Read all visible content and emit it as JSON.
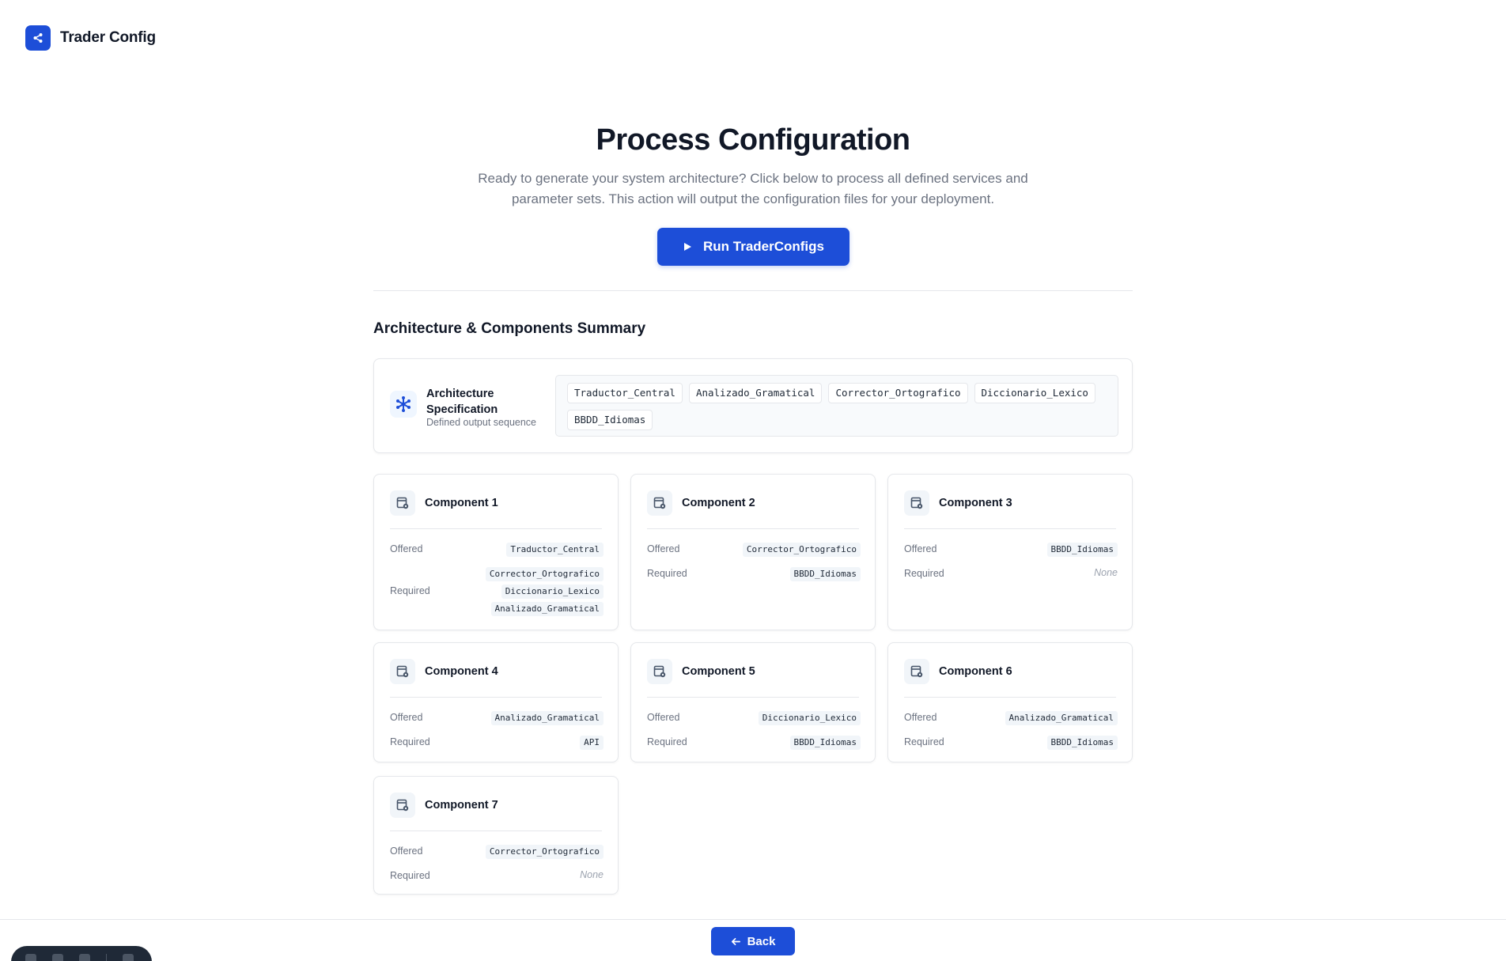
{
  "app": {
    "name": "Trader Config",
    "logo_icon": "share-nodes-icon"
  },
  "hero": {
    "title": "Process Configuration",
    "subtitle": "Ready to generate your system architecture? Click below to process all defined services and parameter sets. This action will output the configuration files for your deployment.",
    "run_label": "Run TraderConfigs"
  },
  "summary": {
    "title": "Architecture & Components Summary",
    "architecture": {
      "title": "Architecture Specification",
      "subtitle": "Defined output sequence",
      "sequence": [
        "Traductor_Central",
        "Analizado_Gramatical",
        "Corrector_Ortografico",
        "Diccionario_Lexico",
        "BBDD_Idiomas"
      ]
    },
    "offered_label": "Offered",
    "required_label": "Required",
    "none_label": "None",
    "components": [
      {
        "name": "Component 1",
        "offered": [
          "Traductor_Central"
        ],
        "required": [
          "Corrector_Ortografico",
          "Diccionario_Lexico",
          "Analizado_Gramatical"
        ]
      },
      {
        "name": "Component 2",
        "offered": [
          "Corrector_Ortografico"
        ],
        "required": [
          "BBDD_Idiomas"
        ]
      },
      {
        "name": "Component 3",
        "offered": [
          "BBDD_Idiomas"
        ],
        "required": []
      },
      {
        "name": "Component 4",
        "offered": [
          "Analizado_Gramatical"
        ],
        "required": [
          "API"
        ]
      },
      {
        "name": "Component 5",
        "offered": [
          "Diccionario_Lexico"
        ],
        "required": [
          "BBDD_Idiomas"
        ]
      },
      {
        "name": "Component 6",
        "offered": [
          "Analizado_Gramatical"
        ],
        "required": [
          "BBDD_Idiomas"
        ]
      },
      {
        "name": "Component 7",
        "offered": [
          "Corrector_Ortografico"
        ],
        "required": []
      }
    ]
  },
  "footer": {
    "back_label": "Back"
  },
  "colors": {
    "primary": "#1d4ed8",
    "text": "#111827",
    "muted": "#6b7280",
    "border": "#e5e7eb"
  }
}
